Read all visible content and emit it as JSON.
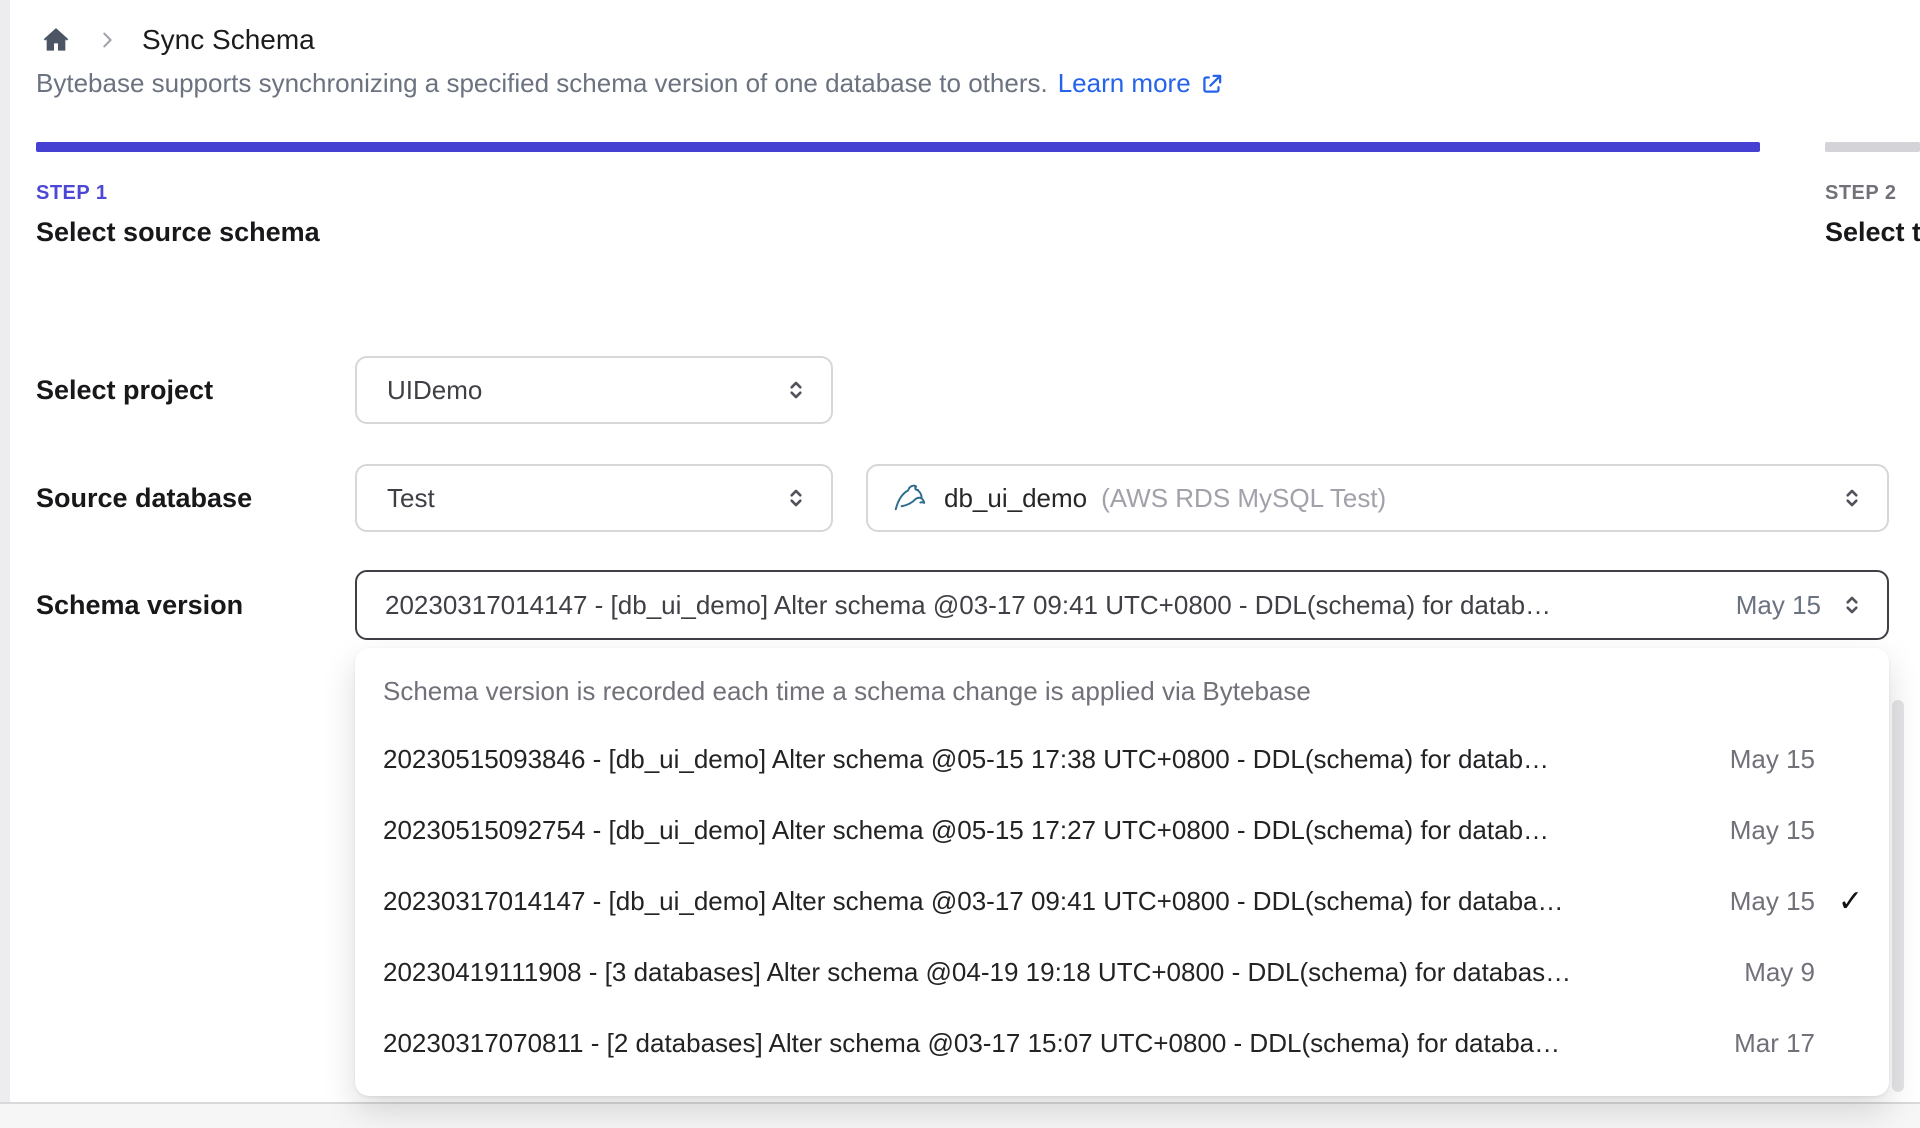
{
  "breadcrumb": {
    "title": "Sync Schema",
    "home_icon": "home-icon",
    "separator_icon": "chevron-right-icon"
  },
  "intro": {
    "text": "Bytebase supports synchronizing a specified schema version of one database to others.",
    "link_label": "Learn more",
    "link_icon": "external-link-icon"
  },
  "steps": [
    {
      "step_label": "STEP 1",
      "title": "Select source schema",
      "active": true
    },
    {
      "step_label": "STEP 2",
      "title": "Select t",
      "active": false
    }
  ],
  "form": {
    "project": {
      "label": "Select project",
      "value": "UIDemo"
    },
    "source_database": {
      "label": "Source database",
      "environment_value": "Test",
      "database": {
        "icon": "mysql-icon",
        "name": "db_ui_demo",
        "detail": "(AWS RDS MySQL Test)"
      }
    },
    "schema_version": {
      "label": "Schema version",
      "value": "20230317014147 - [db_ui_demo] Alter schema @03-17 09:41 UTC+0800 - DDL(schema) for datab…",
      "date": "May 15"
    }
  },
  "dropdown": {
    "header": "Schema version is recorded each time a schema change is applied via Bytebase",
    "options": [
      {
        "text": "20230515093846 - [db_ui_demo] Alter schema @05-15 17:38 UTC+0800 - DDL(schema) for datab…",
        "date": "May 15",
        "selected": false
      },
      {
        "text": "20230515092754 - [db_ui_demo] Alter schema @05-15 17:27 UTC+0800 - DDL(schema) for datab…",
        "date": "May 15",
        "selected": false
      },
      {
        "text": "20230317014147 - [db_ui_demo] Alter schema @03-17 09:41 UTC+0800 - DDL(schema) for databa…",
        "date": "May 15",
        "selected": true
      },
      {
        "text": "20230419111908 - [3 databases] Alter schema @04-19 19:18 UTC+0800 - DDL(schema) for databas…",
        "date": "May 9",
        "selected": false
      },
      {
        "text": "20230317070811 - [2 databases] Alter schema @03-17 15:07 UTC+0800 - DDL(schema) for databa…",
        "date": "Mar 17",
        "selected": false
      }
    ]
  },
  "icons": {
    "check": "✓"
  },
  "colors": {
    "accent_indigo": "#453fd2",
    "link_blue": "#2563eb",
    "inactive_gray": "#d4d4d8",
    "text_muted": "#71717a",
    "focus_border": "#3f3f46"
  }
}
